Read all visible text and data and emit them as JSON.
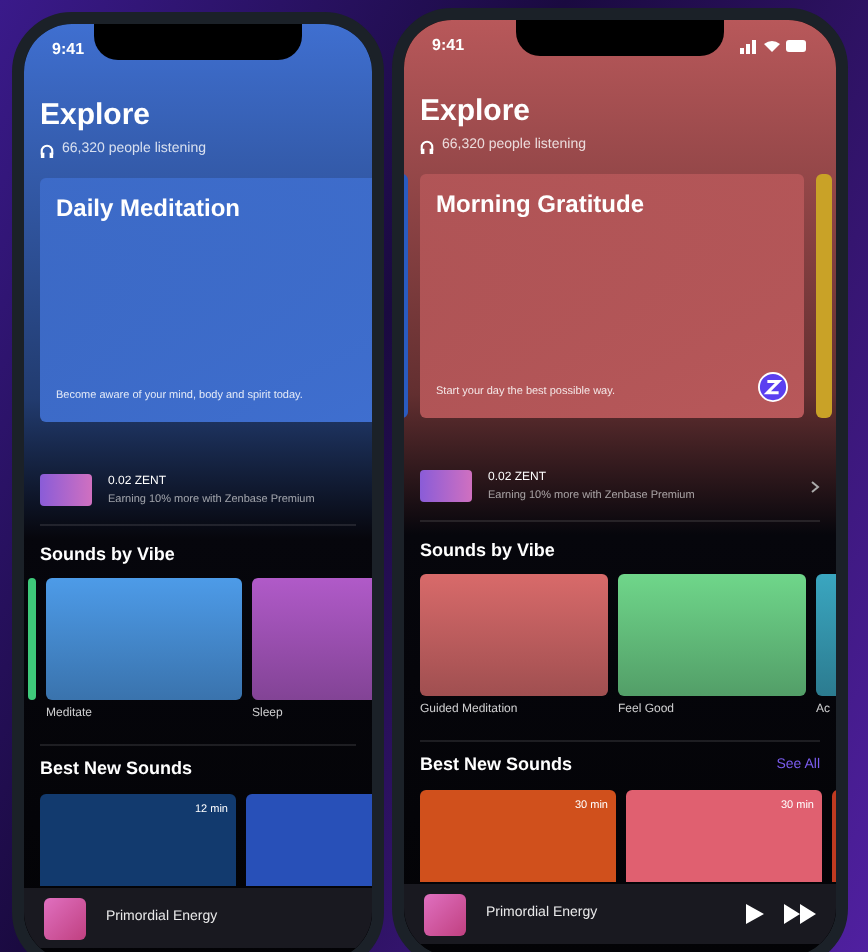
{
  "phones": [
    {
      "time": "9:41",
      "status_icons": false,
      "title": "Explore",
      "listeners": "66,320 people listening",
      "carousel": [
        {
          "kind": "card",
          "title": "Daily Meditation",
          "caption": "Become aware of your mind, body and spirit today.",
          "color": "#3f6fd0"
        }
      ],
      "reward": {
        "amount": "0.02 ZENT",
        "note": "Earning 10% more with Zenbase Premium",
        "chevron": false
      },
      "vibe_title": "Sounds by Vibe",
      "vibes": [
        {
          "kind": "peek",
          "color": "#3ec97a"
        },
        {
          "kind": "tile",
          "label": "Meditate",
          "color": "#4d9be8"
        },
        {
          "kind": "tile",
          "label": "Sleep",
          "color": "#b05ac8"
        }
      ],
      "new_title": "Best New Sounds",
      "sounds": [
        {
          "duration": "12 min",
          "color": "#123a6e"
        },
        {
          "color": "#2850b8"
        }
      ],
      "player": {
        "track": "Primordial Energy",
        "controls": false
      }
    },
    {
      "time": "9:41",
      "status_icons": true,
      "title": "Explore",
      "listeners": "66,320 people listening",
      "carousel": [
        {
          "kind": "peek",
          "color": "#2a5bc0"
        },
        {
          "kind": "card",
          "title": "Morning Gratitude",
          "caption": "Start your day the best possible way.",
          "color": "#b8585a",
          "badge": true
        },
        {
          "kind": "peek",
          "color": "#c9a227"
        }
      ],
      "reward": {
        "amount": "0.02 ZENT",
        "note": "Earning 10% more with Zenbase Premium",
        "chevron": true
      },
      "vibe_title": "Sounds by Vibe",
      "vibes": [
        {
          "kind": "tile",
          "label": "Guided Meditation",
          "color": "#d86a6a"
        },
        {
          "kind": "tile",
          "label": "Feel Good",
          "color": "#6fd68a"
        },
        {
          "kind": "tile",
          "label": "Ac",
          "color": "#3aa6c0"
        }
      ],
      "new_title": "Best New Sounds",
      "see_all": "See All",
      "sounds": [
        {
          "duration": "30 min",
          "color": "#d0501c"
        },
        {
          "duration": "30 min",
          "color": "#e06070"
        },
        {
          "color": "#c03a20"
        }
      ],
      "player": {
        "track": "Primordial Energy",
        "controls": true
      }
    }
  ]
}
